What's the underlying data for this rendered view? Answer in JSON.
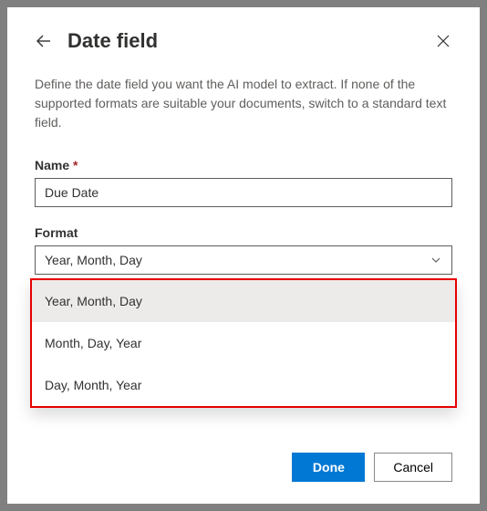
{
  "header": {
    "title": "Date field"
  },
  "description": "Define the date field you want the AI model to extract. If none of the supported formats are suitable your documents, switch to a standard text field.",
  "fields": {
    "name": {
      "label": "Name",
      "required_marker": "*",
      "value": "Due Date"
    },
    "format": {
      "label": "Format",
      "selected": "Year, Month, Day",
      "options": [
        "Year, Month, Day",
        "Month, Day, Year",
        "Day, Month, Year"
      ]
    }
  },
  "footer": {
    "done": "Done",
    "cancel": "Cancel"
  }
}
